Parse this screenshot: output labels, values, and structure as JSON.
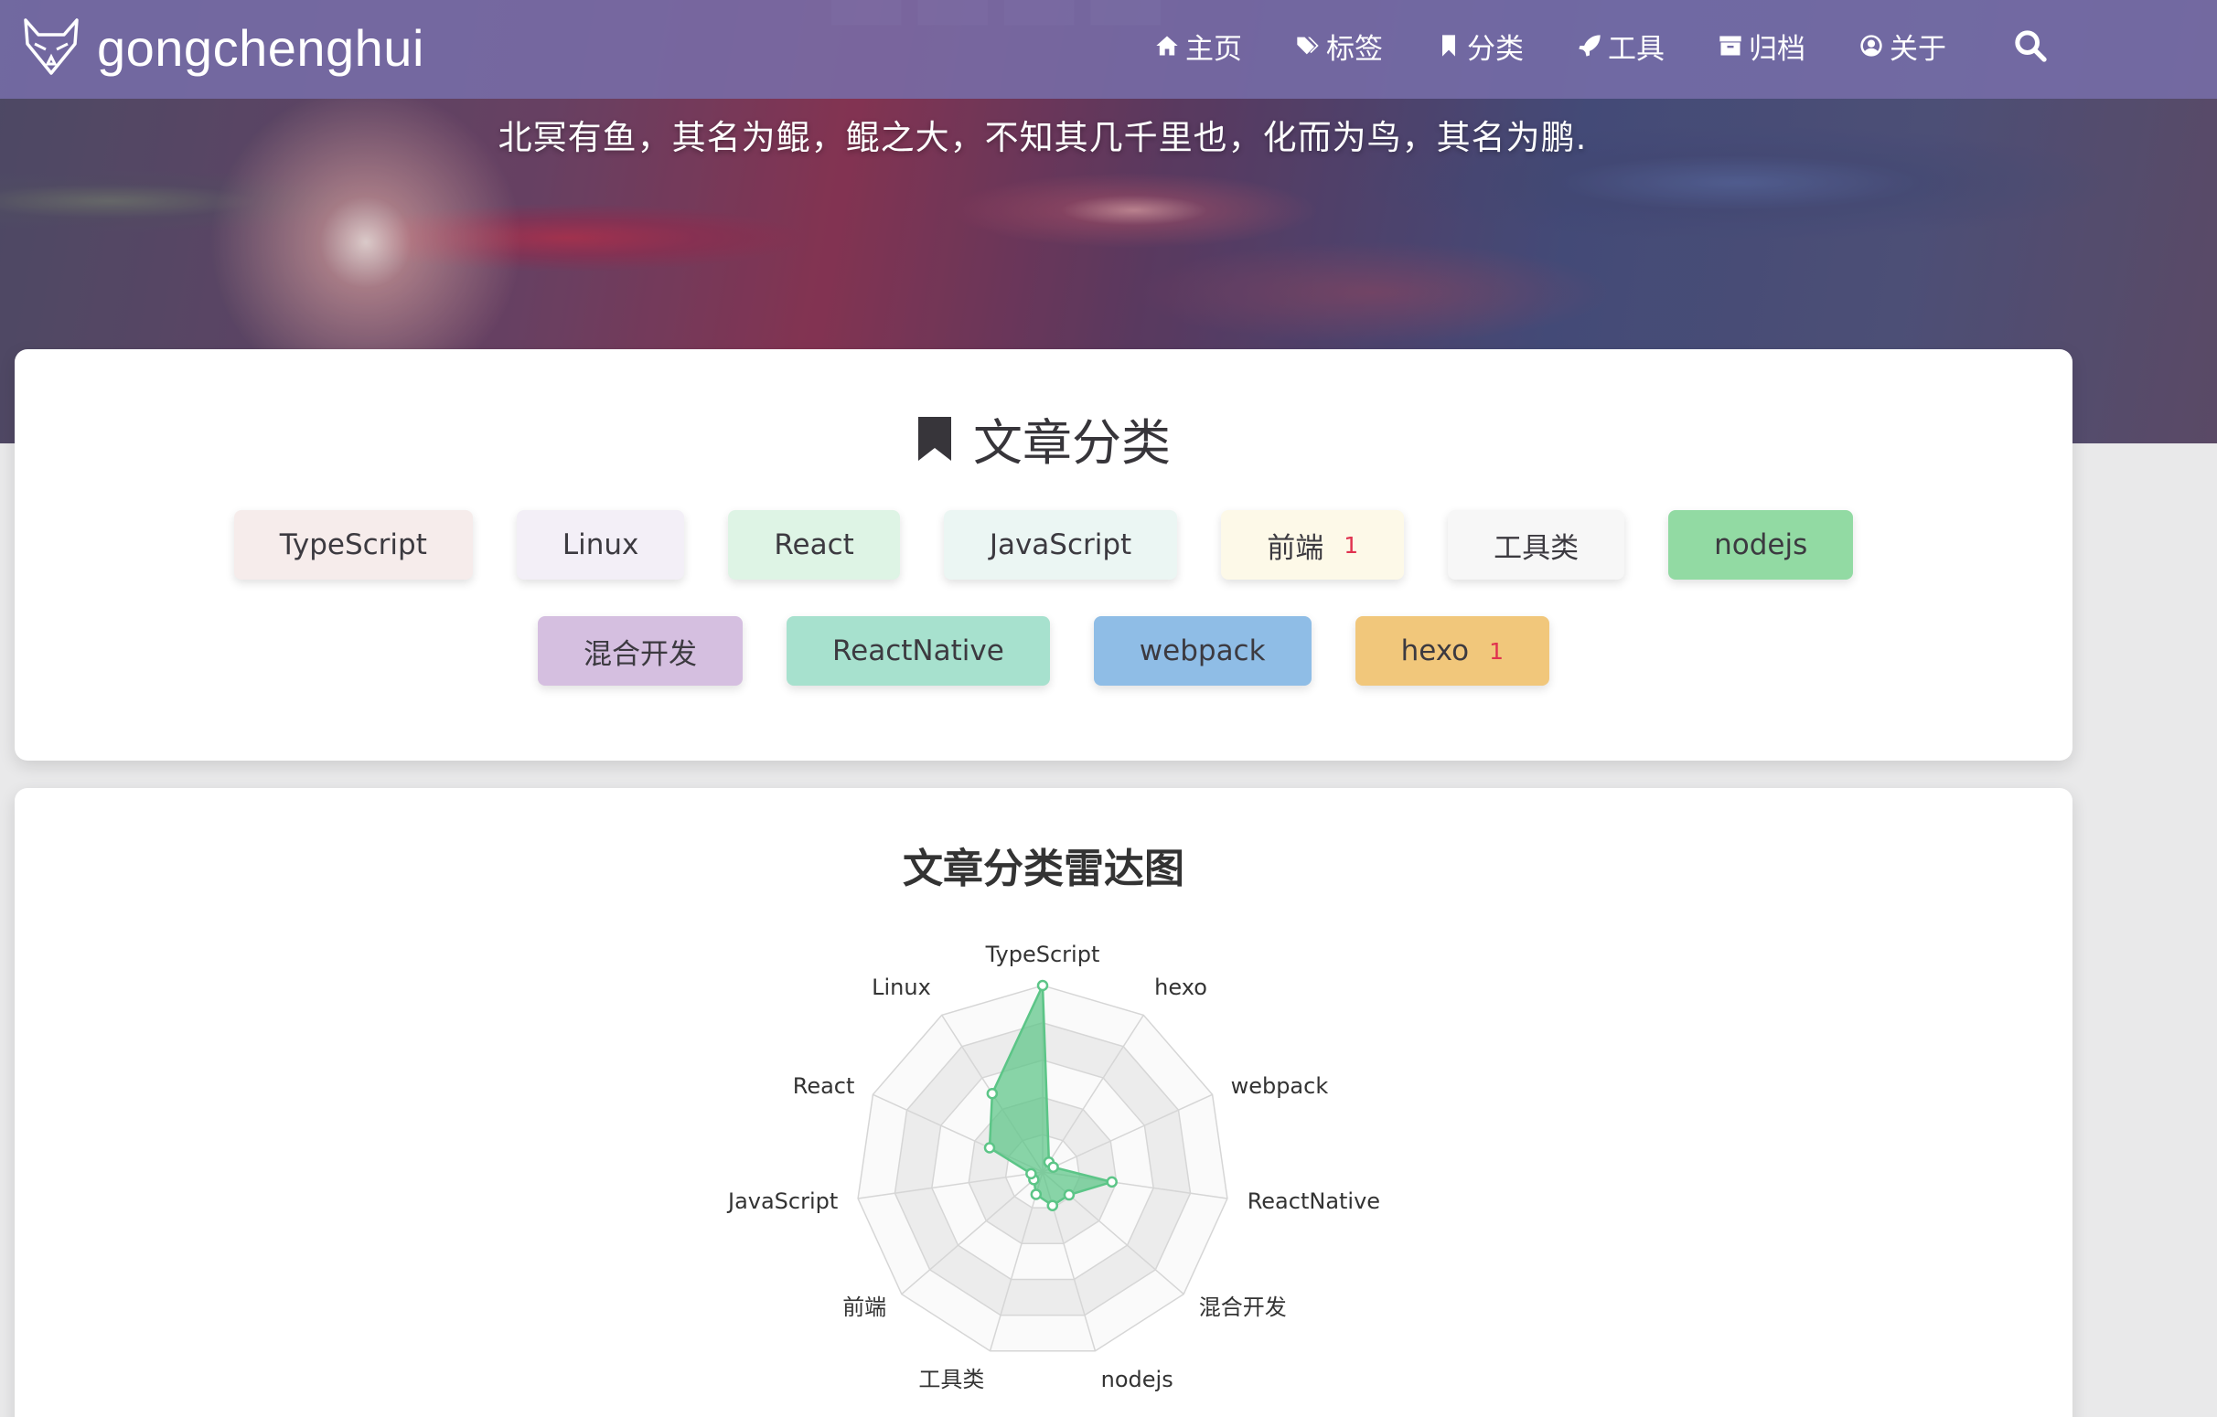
{
  "header": {
    "brand": "gongchenghui",
    "nav": [
      {
        "label": "主页",
        "icon": "home-icon"
      },
      {
        "label": "标签",
        "icon": "tags-icon"
      },
      {
        "label": "分类",
        "icon": "bookmark-icon"
      },
      {
        "label": "工具",
        "icon": "rocket-icon"
      },
      {
        "label": "归档",
        "icon": "archive-icon"
      },
      {
        "label": "关于",
        "icon": "user-circle-icon"
      }
    ],
    "search_icon": "search-icon"
  },
  "hero": {
    "tagline": "北冥有鱼，其名为鲲，鲲之大，不知其几千里也，化而为鸟，其名为鹏."
  },
  "categories": {
    "title": "文章分类",
    "row1": [
      {
        "name": "TypeScript",
        "count": "",
        "color": "#f6eceb"
      },
      {
        "name": "Linux",
        "count": "",
        "color": "#f3eff7"
      },
      {
        "name": "React",
        "count": "",
        "color": "#def4e5"
      },
      {
        "name": "JavaScript",
        "count": "",
        "color": "#ebf6f3"
      },
      {
        "name": "前端",
        "count": "1",
        "color": "#fdf9e8"
      },
      {
        "name": "工具类",
        "count": "",
        "color": "#f7f7f7"
      },
      {
        "name": "nodejs",
        "count": "",
        "color": "#92daa3"
      }
    ],
    "row2": [
      {
        "name": "混合开发",
        "count": "",
        "color": "#d5bfe0"
      },
      {
        "name": "ReactNative",
        "count": "",
        "color": "#a7e1ce"
      },
      {
        "name": "webpack",
        "count": "",
        "color": "#8fbde6"
      },
      {
        "name": "hexo",
        "count": "1",
        "color": "#f1c77b"
      }
    ]
  },
  "radar": {
    "title": "文章分类雷达图"
  },
  "chart_data": {
    "type": "radar",
    "title": "文章分类雷达图",
    "indicators": [
      "TypeScript",
      "hexo",
      "webpack",
      "ReactNative",
      "混合开发",
      "nodejs",
      "工具类",
      "前端",
      "JavaScript",
      "React",
      "Linux"
    ],
    "values": [
      16,
      1,
      1,
      6,
      3,
      3,
      2,
      1,
      1,
      5,
      8
    ],
    "max": 16,
    "color": "#5cc587"
  }
}
